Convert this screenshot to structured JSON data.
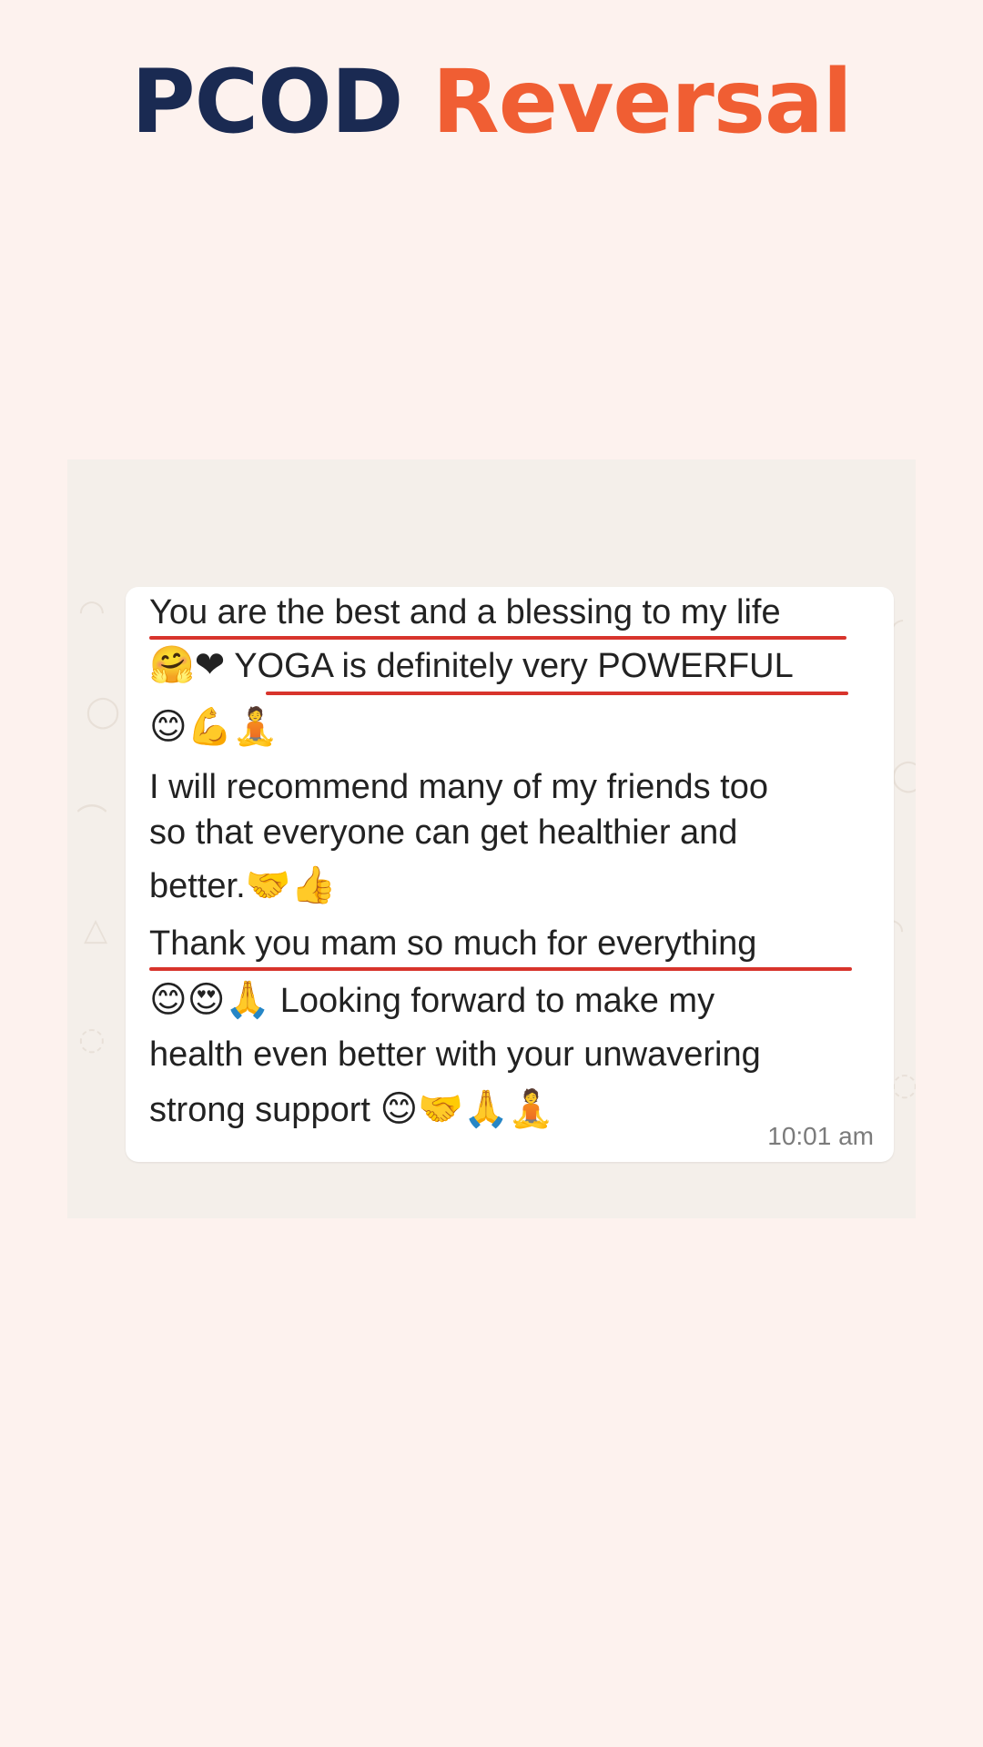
{
  "header": {
    "title_part1": "PCOD",
    "title_part2": "Reversal"
  },
  "message": {
    "lines": [
      "You are the best and a blessing to my life",
      "YOGA is definitely very POWERFUL",
      "I will recommend many of my friends too",
      "so that everyone can get healthier and",
      "better.",
      "Thank you mam so much for everything",
      "Looking forward to make my",
      "health even better with your unwavering",
      "strong support"
    ],
    "emojis": {
      "line2_lead": "🤗❤",
      "line3": "😊💪🧘",
      "line5_trail": "🤝👍",
      "line7_lead": "😊😍🙏",
      "line9_trail": "😊🤝🙏🧘"
    },
    "timestamp": "10:01 am"
  },
  "colors": {
    "background": "#fdf2ee",
    "title_dark": "#1a2a52",
    "title_accent": "#f05e33",
    "underline": "#d8342c"
  }
}
